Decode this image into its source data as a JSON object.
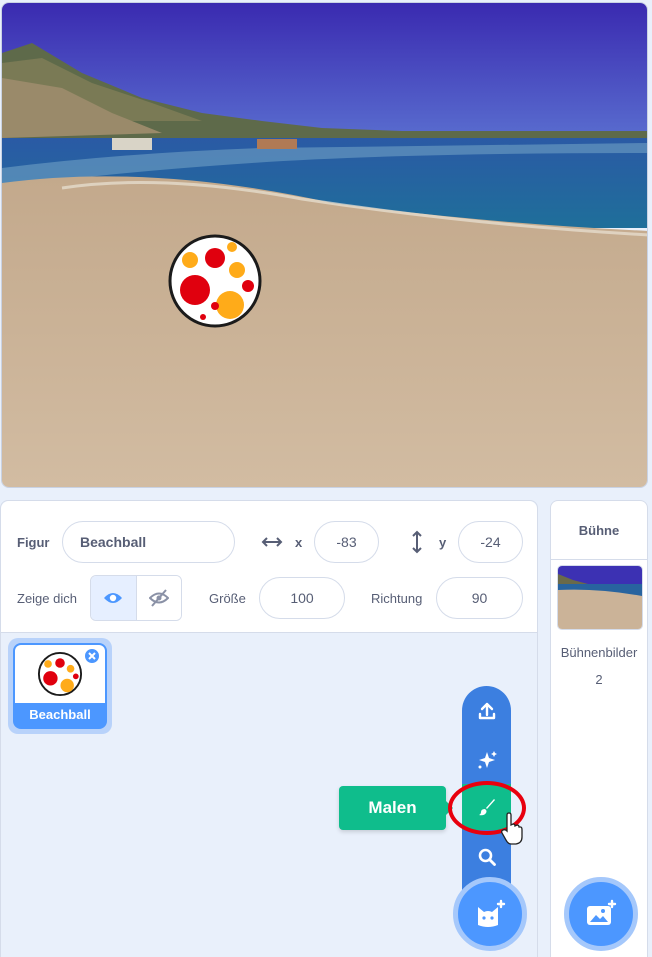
{
  "sprite_info": {
    "sprite_label": "Figur",
    "sprite_name": "Beachball",
    "x_label": "x",
    "x_value": "-83",
    "y_label": "y",
    "y_value": "-24",
    "show_label": "Zeige dich",
    "size_label": "Größe",
    "size_value": "100",
    "direction_label": "Richtung",
    "direction_value": "90"
  },
  "sprite_list": [
    {
      "name": "Beachball"
    }
  ],
  "sprite_menu": {
    "tooltip": "Malen",
    "items": [
      "upload-icon",
      "surprise-icon",
      "paint-icon",
      "search-icon"
    ],
    "main_button_icon": "choose-sprite-cat-icon"
  },
  "stage_pane": {
    "title": "Bühne",
    "backdrops_label": "Bühnenbilder",
    "backdrops_count": "2",
    "add_backdrop_icon": "choose-backdrop-icon"
  },
  "colors": {
    "accent": "#4c97ff",
    "paint_active": "#0fbd8c",
    "highlight_ring": "#e8000e"
  }
}
